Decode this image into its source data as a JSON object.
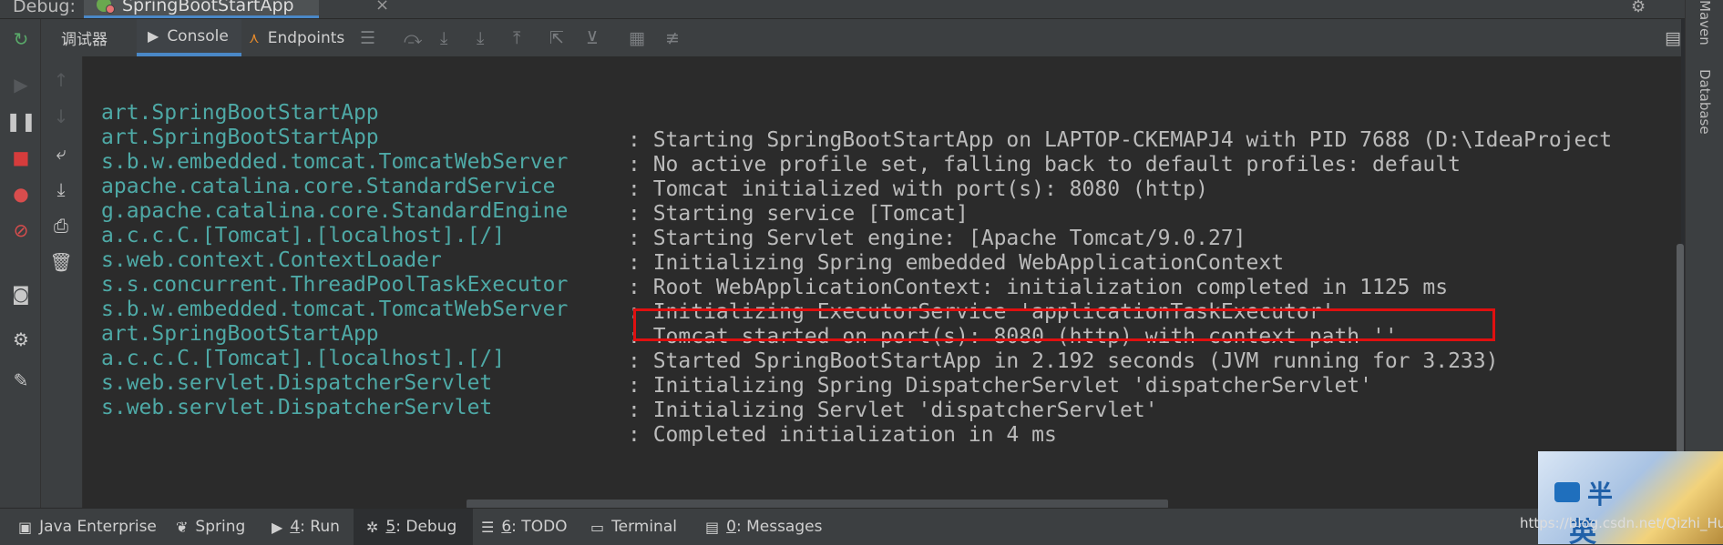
{
  "header": {
    "debug_label": "Debug:",
    "session_tab": "SpringBootStartApp",
    "close": "×"
  },
  "subtabs": {
    "debugger": "调试器",
    "console": "Console",
    "endpoints": "Endpoints"
  },
  "console": {
    "lines": [
      {
        "logger": "art.SpringBootStartApp",
        "msg": ": Starting SpringBootStartApp on LAPTOP-CKEMAPJ4 with PID 7688 (D:\\IdeaProject"
      },
      {
        "logger": "art.SpringBootStartApp",
        "msg": ": No active profile set, falling back to default profiles: default"
      },
      {
        "logger": "s.b.w.embedded.tomcat.TomcatWebServer",
        "msg": ": Tomcat initialized with port(s): 8080 (http)"
      },
      {
        "logger": "apache.catalina.core.StandardService",
        "msg": ": Starting service [Tomcat]"
      },
      {
        "logger": "g.apache.catalina.core.StandardEngine",
        "msg": ": Starting Servlet engine: [Apache Tomcat/9.0.27]"
      },
      {
        "logger": "a.c.c.C.[Tomcat].[localhost].[/]",
        "msg": ": Initializing Spring embedded WebApplicationContext"
      },
      {
        "logger": "s.web.context.ContextLoader",
        "msg": ": Root WebApplicationContext: initialization completed in 1125 ms"
      },
      {
        "logger": "s.s.concurrent.ThreadPoolTaskExecutor",
        "msg": ": Initializing ExecutorService 'applicationTaskExecutor'"
      },
      {
        "logger": "s.b.w.embedded.tomcat.TomcatWebServer",
        "msg": ": Tomcat started on port(s): 8080 (http) with context path ''"
      },
      {
        "logger": "art.SpringBootStartApp",
        "msg": ": Started SpringBootStartApp in 2.192 seconds (JVM running for 3.233)"
      },
      {
        "logger": "a.c.c.C.[Tomcat].[localhost].[/]",
        "msg": ": Initializing Spring DispatcherServlet 'dispatcherServlet'"
      },
      {
        "logger": "s.web.servlet.DispatcherServlet",
        "msg": ": Initializing Servlet 'dispatcherServlet'"
      },
      {
        "logger": "s.web.servlet.DispatcherServlet",
        "msg": ": Completed initialization in 4 ms"
      }
    ],
    "highlighted_line_index": 8
  },
  "right_strip": {
    "maven": "Maven",
    "database": "Database"
  },
  "bottom_tabs": {
    "java_enterprise": "Java Enterprise",
    "spring": "Spring",
    "run_num": "4",
    "run": ": Run",
    "debug_num": "5",
    "debug": ": Debug",
    "todo_num": "6",
    "todo": ": TODO",
    "terminal": "Terminal",
    "messages_num": "0",
    "messages": ": Messages"
  },
  "watermark": {
    "url": "https://blog.csdn.net/Qizhi_Hu",
    "avatar_text_1": "半",
    "avatar_text_2": "英"
  },
  "colors": {
    "logger": "#4ea9a6",
    "message": "#bbbbbb",
    "highlight": "#e01010",
    "accent": "#4a88c7"
  }
}
